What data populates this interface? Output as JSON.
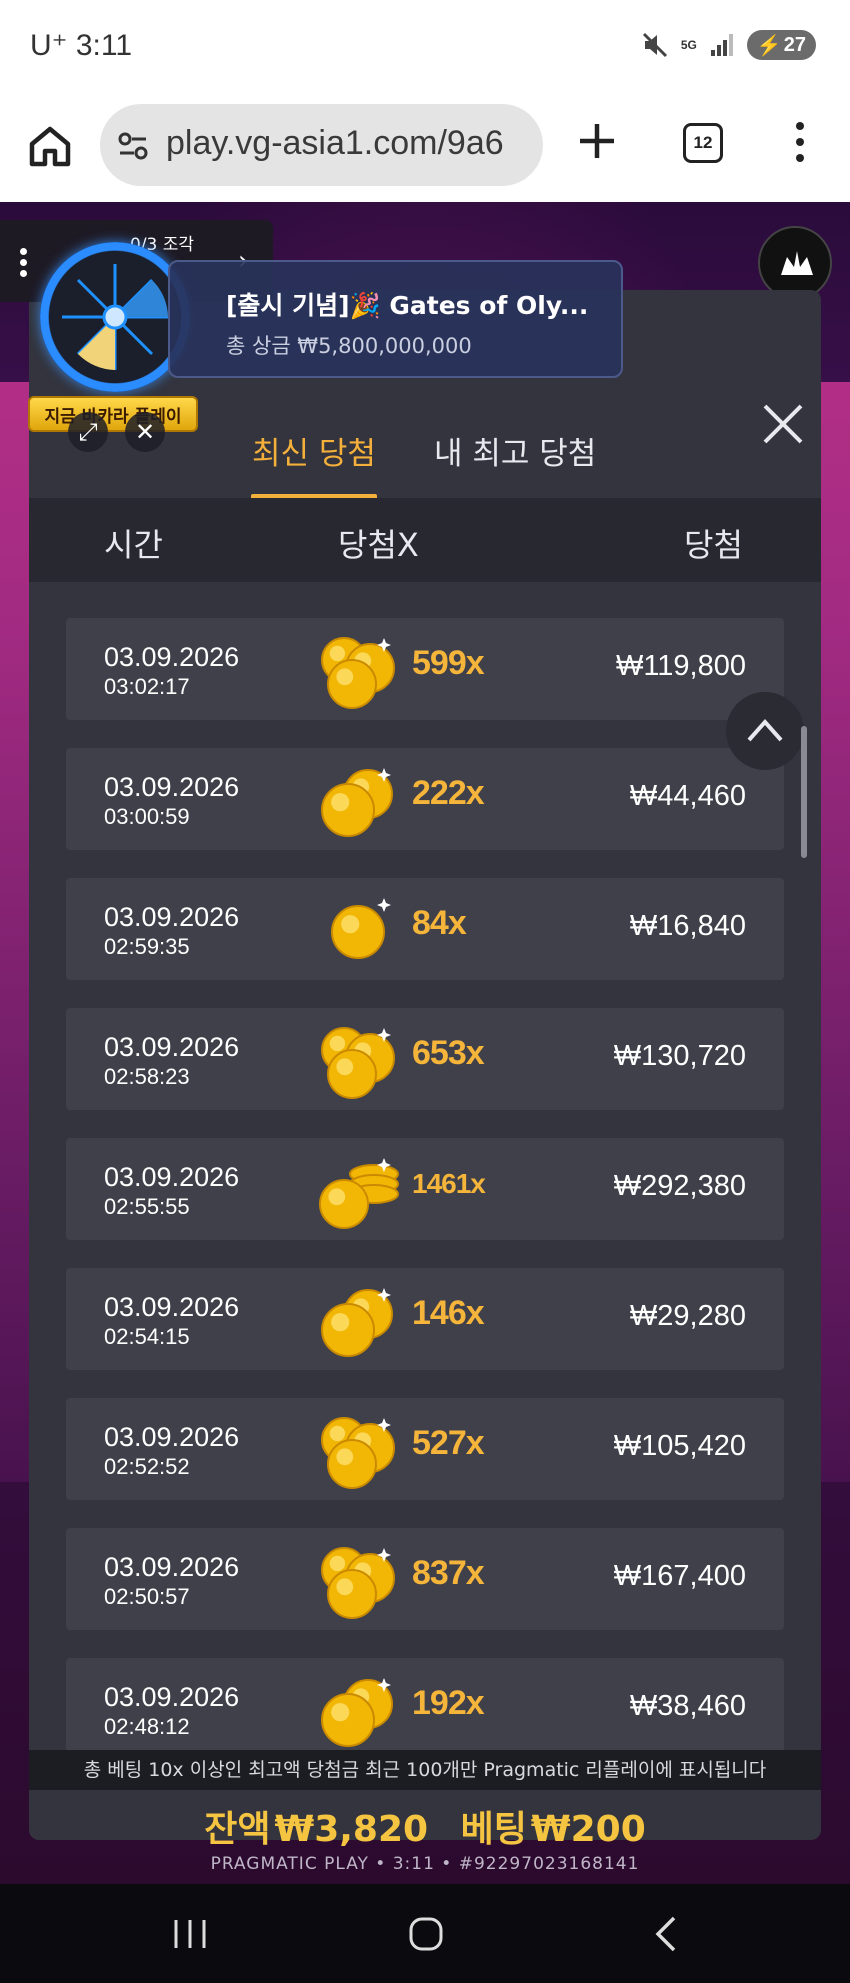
{
  "status": {
    "carrier": "U⁺",
    "time": "3:11",
    "network": "5G",
    "battery": "27"
  },
  "browser": {
    "url": "play.vg-asia1.com/9a6",
    "tab_count": "12"
  },
  "game": {
    "side_tab": {
      "count": "0/3 조각",
      "label": "지금 바카라 플레이"
    },
    "promo": {
      "title": "[출시 기념]🎉 Gates of Oly...",
      "subtitle": "총 상금 ₩5,800,000,000"
    },
    "panel": {
      "tabs": [
        "최신 당첨",
        "내 최고 당첨"
      ],
      "columns": [
        "시간",
        "당첨X",
        "당첨"
      ],
      "rows": [
        {
          "date": "03.09.2026",
          "time": "03:02:17",
          "mult": "599x",
          "win": "₩119,800",
          "coins": 3
        },
        {
          "date": "03.09.2026",
          "time": "03:00:59",
          "mult": "222x",
          "win": "₩44,460",
          "coins": 2
        },
        {
          "date": "03.09.2026",
          "time": "02:59:35",
          "mult": "84x",
          "win": "₩16,840",
          "coins": 1
        },
        {
          "date": "03.09.2026",
          "time": "02:58:23",
          "mult": "653x",
          "win": "₩130,720",
          "coins": 3
        },
        {
          "date": "03.09.2026",
          "time": "02:55:55",
          "mult": "1461x",
          "win": "₩292,380",
          "coins": 4
        },
        {
          "date": "03.09.2026",
          "time": "02:54:15",
          "mult": "146x",
          "win": "₩29,280",
          "coins": 2
        },
        {
          "date": "03.09.2026",
          "time": "02:52:52",
          "mult": "527x",
          "win": "₩105,420",
          "coins": 3
        },
        {
          "date": "03.09.2026",
          "time": "02:50:57",
          "mult": "837x",
          "win": "₩167,400",
          "coins": 3
        },
        {
          "date": "03.09.2026",
          "time": "02:48:12",
          "mult": "192x",
          "win": "₩38,460",
          "coins": 2
        }
      ],
      "footer_note": "총 베팅 10x 이상인 최고액 당첨금 최근 100개만 Pragmatic 리플레이에 표시됩니다"
    },
    "balance": {
      "balance_label": "잔액",
      "balance_value": "₩3,820",
      "bet_label": "베팅",
      "bet_value": "₩200"
    },
    "footer": "PRAGMATIC PLAY • 3:11 • #92297023168141"
  },
  "colors": {
    "accent_gold": "#f4b03a",
    "panel_bg": "#33343d",
    "row_bg": "#3f4049"
  }
}
